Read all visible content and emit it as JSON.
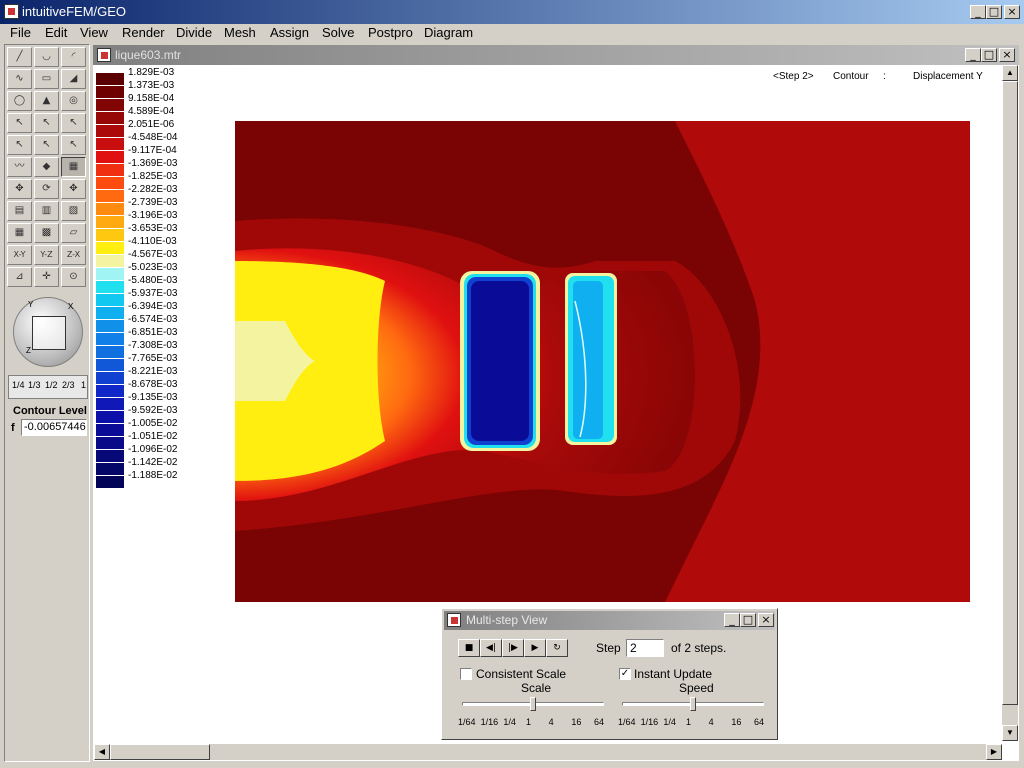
{
  "app": {
    "title": "intuitiveFEM/GEO"
  },
  "menu": [
    "File",
    "Edit",
    "View",
    "Render",
    "Divide",
    "Mesh",
    "Assign",
    "Solve",
    "Postpro",
    "Diagram"
  ],
  "toolbox": {
    "view_axes": {
      "a": "Y",
      "b": "X",
      "c": "Z"
    },
    "scale_labels": [
      "1/4",
      "1/3",
      "1/2",
      "2/3",
      "1"
    ],
    "contour_level_label": "Contour Level",
    "f_label": "f",
    "f_value": "-0.00657446"
  },
  "document": {
    "title": "lique603.mtr",
    "step_label": "<Step 2>",
    "mode": "Contour",
    "separator": ":",
    "quantity": "Displacement Y"
  },
  "legend": [
    {
      "value": "1.829E-03",
      "color": "#5a0000"
    },
    {
      "value": "1.373E-03",
      "color": "#6e0000"
    },
    {
      "value": "9.158E-04",
      "color": "#820505"
    },
    {
      "value": "4.589E-04",
      "color": "#960808"
    },
    {
      "value": "2.051E-06",
      "color": "#aa0a0a"
    },
    {
      "value": "-4.548E-04",
      "color": "#c80e0e"
    },
    {
      "value": "-9.117E-04",
      "color": "#e01010"
    },
    {
      "value": "-1.369E-03",
      "color": "#f02e10"
    },
    {
      "value": "-1.825E-03",
      "color": "#ff4a10"
    },
    {
      "value": "-2.282E-03",
      "color": "#ff6a10"
    },
    {
      "value": "-2.739E-03",
      "color": "#ff8a10"
    },
    {
      "value": "-3.196E-03",
      "color": "#ffaa10"
    },
    {
      "value": "-3.653E-03",
      "color": "#ffc810"
    },
    {
      "value": "-4.110E-03",
      "color": "#ffee10"
    },
    {
      "value": "-4.567E-03",
      "color": "#f4f4a0"
    },
    {
      "value": "-5.023E-03",
      "color": "#a0f4f4"
    },
    {
      "value": "-5.480E-03",
      "color": "#20e0f0"
    },
    {
      "value": "-5.937E-03",
      "color": "#10c8f0"
    },
    {
      "value": "-6.394E-03",
      "color": "#10b0f0"
    },
    {
      "value": "-6.574E-03",
      "color": "#1090e8"
    },
    {
      "value": "-6.851E-03",
      "color": "#1080e8"
    },
    {
      "value": "-7.308E-03",
      "color": "#1070e0"
    },
    {
      "value": "-7.765E-03",
      "color": "#1058d8"
    },
    {
      "value": "-8.221E-03",
      "color": "#1040d0"
    },
    {
      "value": "-8.678E-03",
      "color": "#1028c8"
    },
    {
      "value": "-9.135E-03",
      "color": "#1018b8"
    },
    {
      "value": "-9.592E-03",
      "color": "#0c10a8"
    },
    {
      "value": "-1.005E-02",
      "color": "#0a0c98"
    },
    {
      "value": "-1.051E-02",
      "color": "#080a88"
    },
    {
      "value": "-1.096E-02",
      "color": "#060878"
    },
    {
      "value": "-1.142E-02",
      "color": "#040668"
    },
    {
      "value": "-1.188E-02",
      "color": "#020458"
    }
  ],
  "dialog": {
    "title": "Multi-step View",
    "step_label": "Step",
    "step_value": "2",
    "of_steps": "of 2 steps.",
    "consistent_scale": {
      "label": "Consistent Scale",
      "checked": false
    },
    "instant_update": {
      "label": "Instant Update",
      "checked": true
    },
    "scale_label": "Scale",
    "speed_label": "Speed",
    "scale_ticks": [
      "1/64",
      "1/16",
      "1/4",
      "1",
      "4",
      "16",
      "64"
    ],
    "speed_ticks": [
      "1/64",
      "1/16",
      "1/4",
      "1",
      "4",
      "16",
      "64"
    ],
    "scale_value": "1",
    "speed_value": "1"
  },
  "icons": {
    "stop": "■",
    "prev": "◀|",
    "next": "|▶",
    "play": "▶",
    "loop": "↻"
  }
}
